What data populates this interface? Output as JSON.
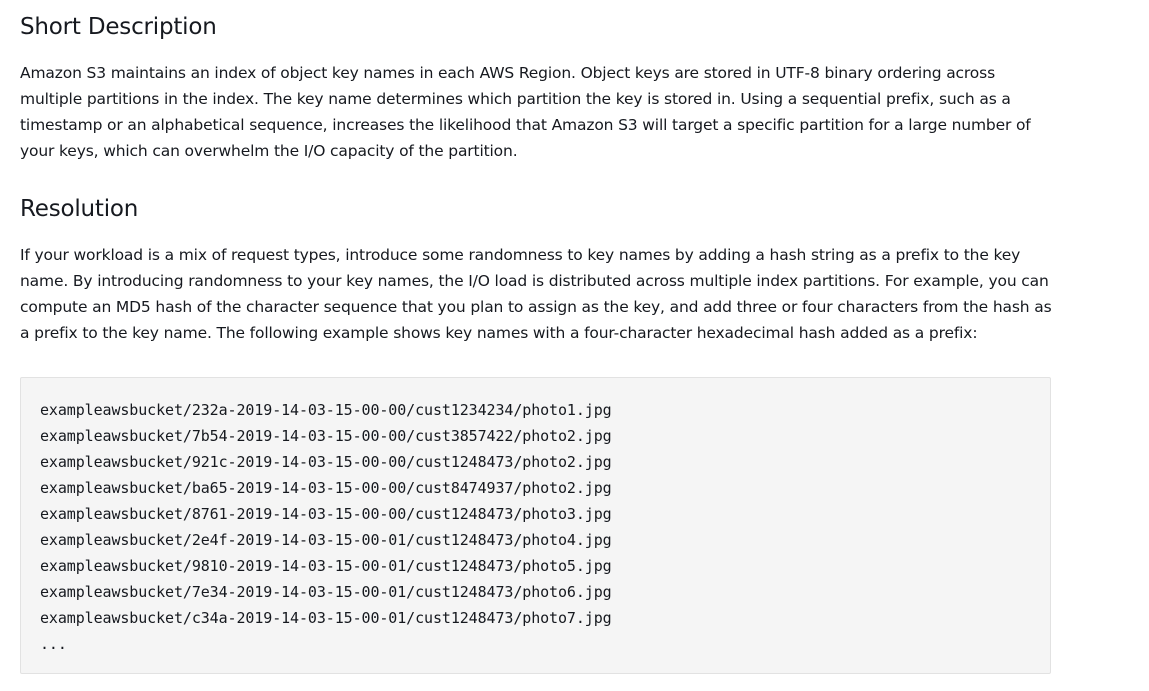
{
  "short_description": {
    "heading": "Short Description",
    "body": "Amazon S3 maintains an index of object key names in each AWS Region. Object keys are stored in UTF-8 binary ordering across multiple partitions in the index. The key name determines which partition the key is stored in. Using a sequential prefix, such as a timestamp or an alphabetical sequence, increases the likelihood that Amazon S3 will target a specific partition for a large number of your keys, which can overwhelm the I/O capacity of the partition."
  },
  "resolution": {
    "heading": "Resolution",
    "body": "If your workload is a mix of request types, introduce some randomness to key names by adding a hash string as a prefix to the key name. By introducing randomness to your key names, the I/O load is distributed across multiple index partitions. For example, you can compute an MD5 hash of the character sequence that you plan to assign as the key, and add three or four characters from the hash as a prefix to the key name. The following example shows key names with a four-character hexadecimal hash added as a prefix:"
  },
  "code_example": {
    "lines": [
      "exampleawsbucket/232a-2019-14-03-15-00-00/cust1234234/photo1.jpg",
      "exampleawsbucket/7b54-2019-14-03-15-00-00/cust3857422/photo2.jpg",
      "exampleawsbucket/921c-2019-14-03-15-00-00/cust1248473/photo2.jpg",
      "exampleawsbucket/ba65-2019-14-03-15-00-00/cust8474937/photo2.jpg",
      "exampleawsbucket/8761-2019-14-03-15-00-00/cust1248473/photo3.jpg",
      "exampleawsbucket/2e4f-2019-14-03-15-00-01/cust1248473/photo4.jpg",
      "exampleawsbucket/9810-2019-14-03-15-00-01/cust1248473/photo5.jpg",
      "exampleawsbucket/7e34-2019-14-03-15-00-01/cust1248473/photo6.jpg",
      "exampleawsbucket/c34a-2019-14-03-15-00-01/cust1248473/photo7.jpg",
      "..."
    ]
  }
}
